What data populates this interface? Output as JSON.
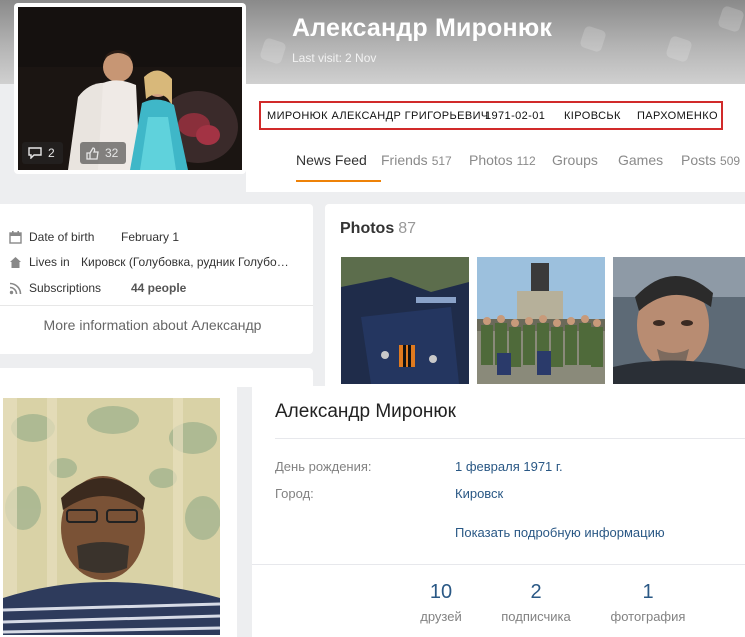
{
  "colors": {
    "accent_orange": "#ee8208",
    "highlight_box": "#d12a2a",
    "vk_link": "#2a5885",
    "vk_label": "#828282"
  },
  "ok_profile": {
    "name": "Александр Миронюк",
    "last_visit_label": "Last visit:",
    "last_visit_value": "2 Nov",
    "avatar_badges": [
      {
        "icon": "comment-icon",
        "count": "2"
      },
      {
        "icon": "like-icon",
        "count": "32"
      }
    ],
    "highlight_box": [
      "МИРОНЮК АЛЕКСАНДР ГРИГОРЬЕВИЧ",
      "1971-02-01",
      "КІРОВСЬК",
      "ПАРХОМЕНКО"
    ],
    "tabs": [
      {
        "label": "News Feed",
        "count": "",
        "active": true
      },
      {
        "label": "Friends",
        "count": "517"
      },
      {
        "label": "Photos",
        "count": "112"
      },
      {
        "label": "Groups",
        "count": ""
      },
      {
        "label": "Games",
        "count": ""
      },
      {
        "label": "Posts",
        "count": "509"
      }
    ],
    "info": {
      "dob_label": "Date of birth",
      "dob_value": "February 1",
      "lives_label": "Lives in",
      "lives_value": "Кировск (Голубовка, рудник Голубо…",
      "subs_label": "Subscriptions",
      "subs_value": "44 people",
      "more_link": "More information about Александр"
    },
    "photos": {
      "title": "Photos",
      "count": "87",
      "thumbs": [
        "photo-thumb-parade",
        "photo-thumb-group-monument",
        "photo-thumb-selfie"
      ]
    }
  },
  "vk_profile": {
    "name": "Александр Миронюк",
    "birthday_label": "День рождения:",
    "birthday_value": "1 февраля 1971 г.",
    "city_label": "Город:",
    "city_value": "Кировск",
    "more_link": "Показать подробную информацию",
    "stats": [
      {
        "value": "10",
        "label": "друзей"
      },
      {
        "value": "2",
        "label": "подписчика"
      },
      {
        "value": "1",
        "label": "фотография"
      }
    ]
  }
}
